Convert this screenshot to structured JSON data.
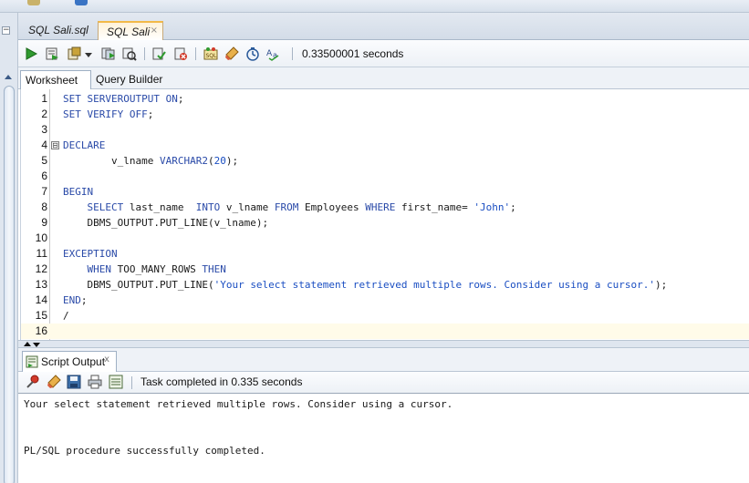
{
  "tabs": [
    {
      "label": "SQL Sali.sql",
      "active": false
    },
    {
      "label": "SQL Sali",
      "active": true,
      "close": "×"
    }
  ],
  "toolbar": {
    "icons": [
      "run-statement-icon",
      "run-script-icon",
      "commit-icon",
      "rollback-icon",
      "explain-plan-icon",
      "autotrace-icon",
      "sql-tuning-icon",
      "clear-icon",
      "history-icon",
      "format-icon"
    ],
    "timing": "0.33500001 seconds"
  },
  "subtabs": {
    "worksheet": "Worksheet",
    "query_builder": "Query Builder"
  },
  "code": {
    "lines": [
      {
        "n": "1",
        "text": "SET SERVEROUTPUT ON;"
      },
      {
        "n": "2",
        "text": "SET VERIFY OFF;"
      },
      {
        "n": "3",
        "text": ""
      },
      {
        "n": "4",
        "text": "DECLARE",
        "fold": "⊟"
      },
      {
        "n": "5",
        "text": "        v_lname VARCHAR2(20);"
      },
      {
        "n": "6",
        "text": ""
      },
      {
        "n": "7",
        "text": "BEGIN"
      },
      {
        "n": "8",
        "text": "    SELECT last_name  INTO v_lname FROM Employees WHERE first_name= 'John';"
      },
      {
        "n": "9",
        "text": "    DBMS_OUTPUT.PUT_LINE(v_lname);"
      },
      {
        "n": "10",
        "text": ""
      },
      {
        "n": "11",
        "text": "EXCEPTION"
      },
      {
        "n": "12",
        "text": "    WHEN TOO_MANY_ROWS THEN"
      },
      {
        "n": "13",
        "text": "    DBMS_OUTPUT.PUT_LINE('Your select statement retrieved multiple rows. Consider using a cursor.');"
      },
      {
        "n": "14",
        "text": "END;"
      },
      {
        "n": "15",
        "text": "/"
      },
      {
        "n": "16",
        "text": ""
      }
    ]
  },
  "output": {
    "tab_label": "Script Output",
    "tab_close": "x",
    "status": "Task completed in 0.335 seconds",
    "lines": [
      "Your select statement retrieved multiple rows. Consider using a cursor.",
      "PL/SQL procedure successfully completed."
    ]
  },
  "colors": {
    "keyword": "#2a4aa8",
    "string": "#1a4ec2",
    "current_line": "#fffbe9",
    "active_tab_accent": "#f2b948"
  }
}
